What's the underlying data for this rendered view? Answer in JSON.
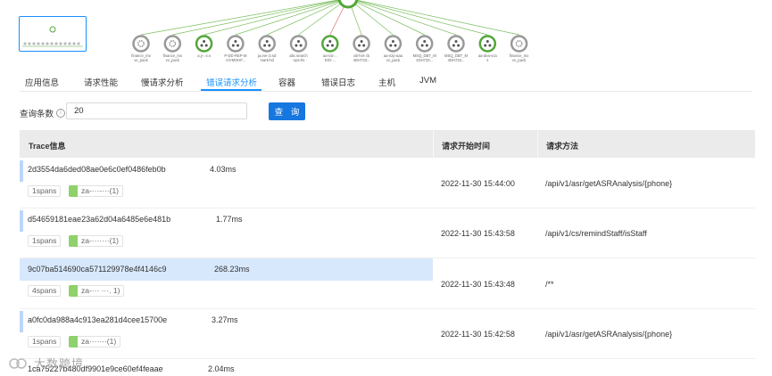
{
  "topology": {
    "nodes": [
      {
        "label": "finance_mx\nvv_pack",
        "color": "#999999",
        "icon": "gear-icon"
      },
      {
        "label": "finance_mx\nvv_pack",
        "color": "#999999",
        "icon": "gear-icon"
      },
      {
        "label": "a.y-..s.s",
        "color": "#52a73a",
        "icon": "person-icon"
      },
      {
        "label": "P-DD-REP-M\nA/VMOHF...",
        "color": "#999999",
        "icon": "person-icon"
      },
      {
        "label": "ja.ew-.b.sd\nmark-hd",
        "color": "#999999",
        "icon": "person-icon"
      },
      {
        "label": "abc.search\n-vps-hs",
        "color": "#999999",
        "icon": "person-icon"
      },
      {
        "label": "aa-rat-...\nDIO-...",
        "color": "#52a73a",
        "icon": "person-icon"
      },
      {
        "label": "ab-hnl-.tb\n4DH733...",
        "color": "#999999",
        "icon": "person-icon"
      },
      {
        "label": "aa-nzp-aaa\nvv_pack",
        "color": "#999999",
        "icon": "person-icon"
      },
      {
        "label": "MSQ_DBT_M\n4DH733...",
        "color": "#999999",
        "icon": "person-icon"
      },
      {
        "label": "MSQ_DBT_M\n4DH733...",
        "color": "#999999",
        "icon": "person-icon"
      },
      {
        "label": "aa-dea-vca\ns",
        "color": "#52a73a",
        "icon": "person-icon"
      },
      {
        "label": "finance_mx\nvv_pack",
        "color": "#999999",
        "icon": "gear-icon"
      }
    ]
  },
  "tabs": [
    {
      "label": "应用信息",
      "active": false
    },
    {
      "label": "请求性能",
      "active": false
    },
    {
      "label": "慢请求分析",
      "active": false
    },
    {
      "label": "错误请求分析",
      "active": true
    },
    {
      "label": "容器",
      "active": false
    },
    {
      "label": "错误日志",
      "active": false
    },
    {
      "label": "主机",
      "active": false
    },
    {
      "label": "JVM",
      "active": false
    }
  ],
  "query": {
    "label": "查询条数",
    "value": "20",
    "button": "查 询"
  },
  "table": {
    "headers": {
      "trace": "Trace信息",
      "start_time": "请求开始时间",
      "method": "请求方法"
    },
    "rows": [
      {
        "trace_id": "2d3554da6ded08ae0e6c0ef0486feb0b",
        "duration": "4.03ms",
        "spans": "1spans",
        "service": "za-···-···(1)",
        "start_time": "2022-11-30 15:44:00",
        "method": "/api/v1/asr/getASRAnalysis/{phone}",
        "selected": false
      },
      {
        "trace_id": "d54659181eae23a62d04a6485e6e481b",
        "duration": "1.77ms",
        "spans": "1spans",
        "service": "za-·······(1)",
        "start_time": "2022-11-30 15:43:58",
        "method": "/api/v1/cs/remindStaff/isStaff",
        "selected": false
      },
      {
        "trace_id": "9c07ba514690ca571129978e4f4146c9",
        "duration": "268.23ms",
        "spans": "4spans",
        "service": "za-··· ···. 1)",
        "start_time": "2022-11-30 15:43:48",
        "method": "/**",
        "selected": true
      },
      {
        "trace_id": "a0fc0da988a4c913ea281d4cee15700e",
        "duration": "3.27ms",
        "spans": "1spans",
        "service": "za·······(1)",
        "start_time": "2022-11-30 15:42:58",
        "method": "/api/v1/asr/getASRAnalysis/{phone}",
        "selected": false
      },
      {
        "trace_id": "1ca75227b480df9901e9ce60ef4feaae",
        "duration": "2.04ms",
        "spans": "",
        "service": "",
        "start_time": "",
        "method": "",
        "selected": false
      }
    ]
  },
  "watermark": {
    "text": "大数跨境"
  },
  "colors": {
    "accent": "#1890ff",
    "button": "#1677e0",
    "ok": "#52a73a",
    "idle": "#999999",
    "service": "#8fd16a",
    "selected_row": "#d8e8fc"
  }
}
